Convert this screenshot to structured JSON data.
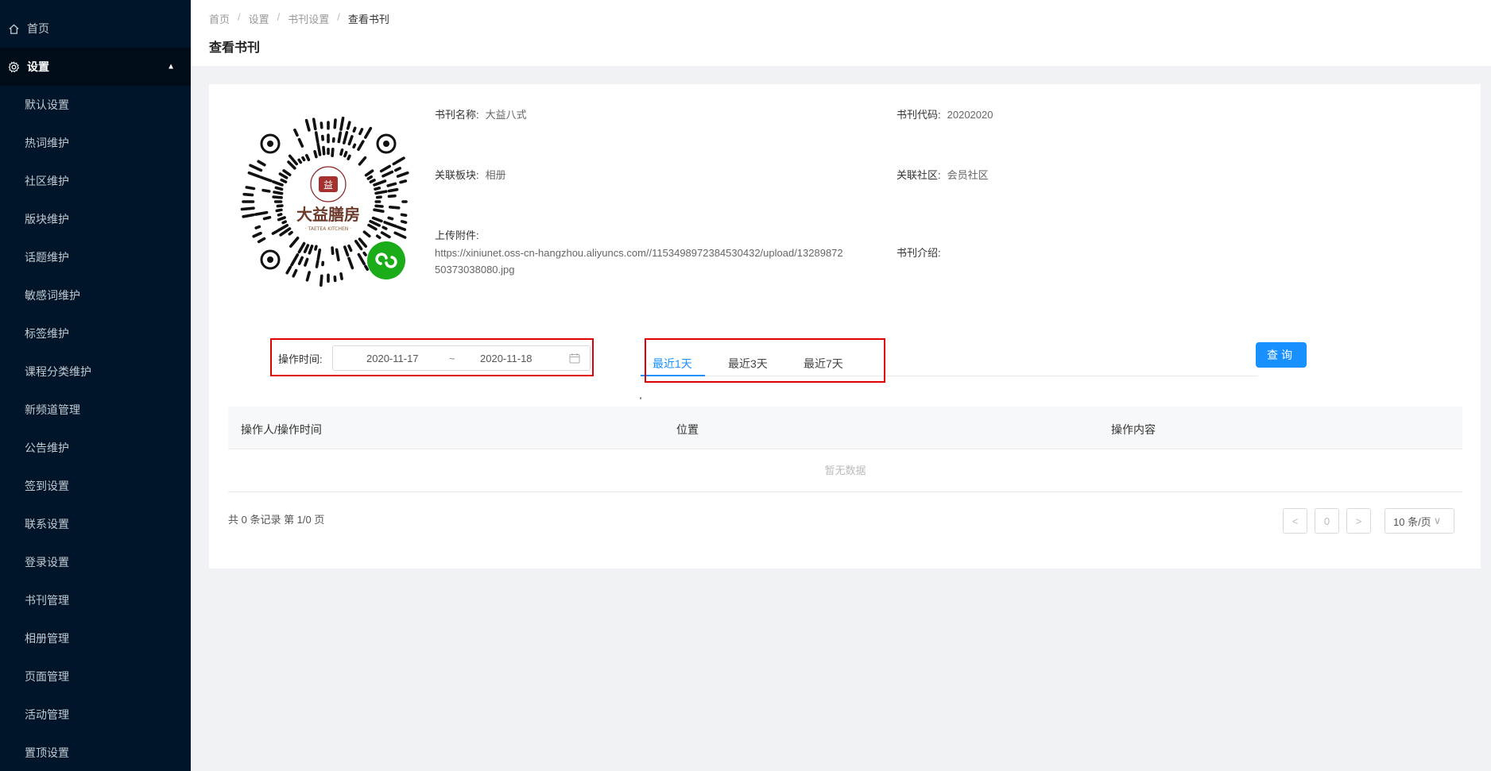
{
  "sidebar": {
    "home_label": "首页",
    "settings_label": "设置",
    "items": [
      "默认设置",
      "热词维护",
      "社区维护",
      "版块维护",
      "话题维护",
      "敏感词维护",
      "标签维护",
      "课程分类维护",
      "新频道管理",
      "公告维护",
      "签到设置",
      "联系设置",
      "登录设置",
      "书刊管理",
      "相册管理",
      "页面管理",
      "活动管理",
      "置顶设置"
    ]
  },
  "breadcrumb": [
    "首页",
    "设置",
    "书刊设置",
    "查看书刊"
  ],
  "page_title": "查看书刊",
  "qr_caption": "大益膳房",
  "qr_caption_en": "· TAETEA KITCHEN ·",
  "detail": {
    "name_label": "书刊名称:",
    "name_value": "大益八式",
    "code_label": "书刊代码:",
    "code_value": "20202020",
    "block_label": "关联板块:",
    "block_value": "相册",
    "community_label": "关联社区:",
    "community_value": "会员社区",
    "attachment_label": "上传附件:",
    "attachment_url": "https://xiniunet.oss-cn-hangzhou.aliyuncs.com//1153498972384530432/upload/1328987250373038080.jpg",
    "intro_label": "书刊介绍:"
  },
  "filter": {
    "date_label": "操作时间:",
    "start_date": "2020-11-17",
    "separator": "~",
    "end_date": "2020-11-18",
    "tabs": [
      "最近1天",
      "最近3天",
      "最近7天"
    ],
    "active_tab": 0,
    "query_button": "查询"
  },
  "table": {
    "columns": [
      "操作人/操作时间",
      "位置",
      "操作内容"
    ],
    "empty_text": "暂无数据"
  },
  "footer": {
    "total_text": "共 0 条记录 第 1/0 页",
    "page_current": "0",
    "page_size": "10 条/页"
  },
  "colors": {
    "sidebar_bg": "#001529",
    "primary": "#1890ff",
    "highlight_border": "#e00000"
  }
}
